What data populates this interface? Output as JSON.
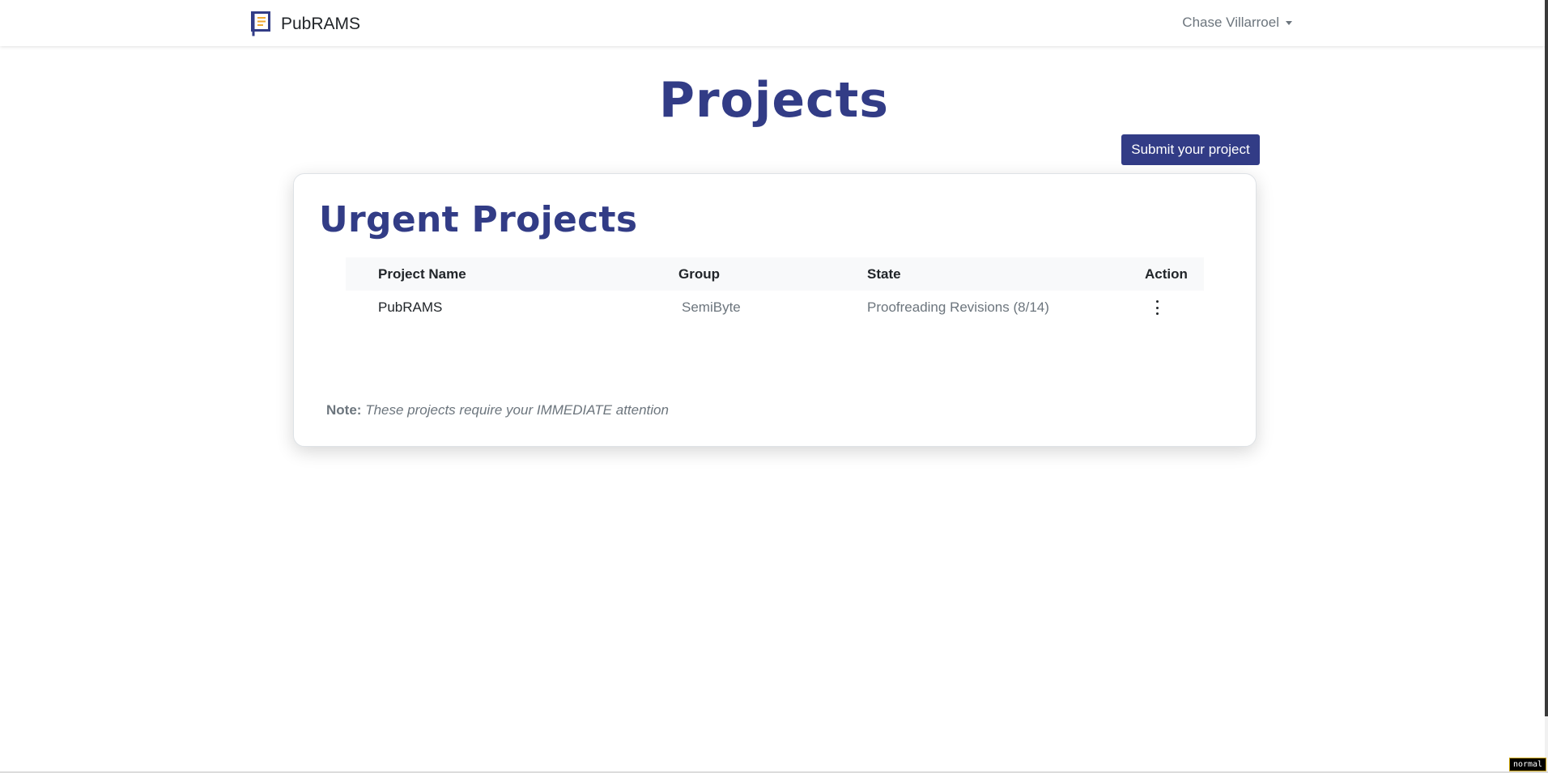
{
  "navbar": {
    "brand_name": "PubRAMS",
    "user_name": "Chase Villarroel"
  },
  "page": {
    "title": "Projects",
    "submit_button_label": "Submit your project"
  },
  "urgent_card": {
    "title": "Urgent Projects",
    "columns": [
      "Project Name",
      "Group",
      "State",
      "Action"
    ],
    "rows": [
      {
        "project_name": "PubRAMS",
        "group": "SemiByte",
        "state": "Proofreading Revisions (8/14)",
        "action_icon": "more-vertical-icon"
      }
    ],
    "note_label": "Note:",
    "note_text": "These projects require your IMMEDIATE attention"
  },
  "status": {
    "mode": "normal"
  },
  "colors": {
    "brand": "#323c86",
    "muted_text": "#6c757d",
    "table_header_bg": "#f8f9fa"
  }
}
